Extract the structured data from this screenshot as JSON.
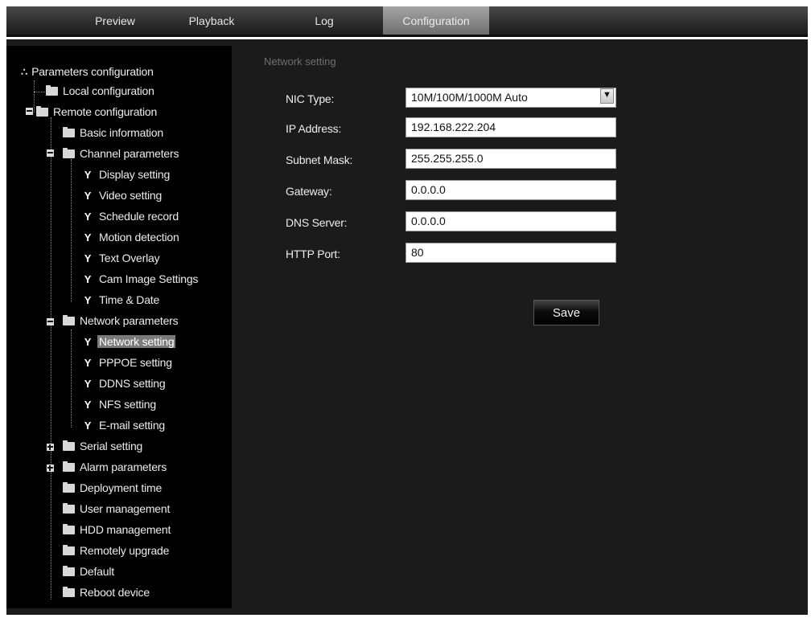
{
  "tabs": [
    {
      "label": "Preview",
      "active": false
    },
    {
      "label": "Playback",
      "active": false
    },
    {
      "label": "Log",
      "active": false
    },
    {
      "label": "Configuration",
      "active": true
    }
  ],
  "tree": {
    "root": "Parameters configuration",
    "local_configuration": "Local configuration",
    "remote_configuration": "Remote configuration",
    "basic_information": "Basic information",
    "channel_parameters": "Channel parameters",
    "display_setting": "Display setting",
    "video_setting": "Video setting",
    "schedule_record": "Schedule record",
    "motion_detection": "Motion detection",
    "text_overlay": "Text Overlay",
    "cam_image_settings": "Cam Image Settings",
    "time_date": "Time & Date",
    "network_parameters": "Network parameters",
    "network_setting": "Network setting",
    "pppoe_setting": "PPPOE setting",
    "ddns_setting": "DDNS setting",
    "nfs_setting": "NFS setting",
    "email_setting": "E-mail setting",
    "serial_setting": "Serial setting",
    "alarm_parameters": "Alarm parameters",
    "deployment_time": "Deployment time",
    "user_management": "User management",
    "hdd_management": "HDD management",
    "remotely_upgrade": "Remotely upgrade",
    "default": "Default",
    "reboot_device": "Reboot device",
    "selected": "Network setting"
  },
  "form": {
    "section_title": "Network setting",
    "nic_type_label": "NIC Type:",
    "nic_type_value": "10M/100M/1000M Auto",
    "ip_address_label": "IP Address:",
    "ip_address_value": "192.168.222.204",
    "subnet_mask_label": "Subnet Mask:",
    "subnet_mask_value": "255.255.255.0",
    "gateway_label": "Gateway:",
    "gateway_value": "0.0.0.0",
    "dns_server_label": "DNS Server:",
    "dns_server_value": "0.0.0.0",
    "http_port_label": "HTTP Port:",
    "http_port_value": "80",
    "save_label": "Save"
  },
  "colors": {
    "background": "#1b1b1b",
    "sidebar": "#000000",
    "active_tab": "#8a8a8a",
    "selected_item": "#7a7a7a"
  }
}
